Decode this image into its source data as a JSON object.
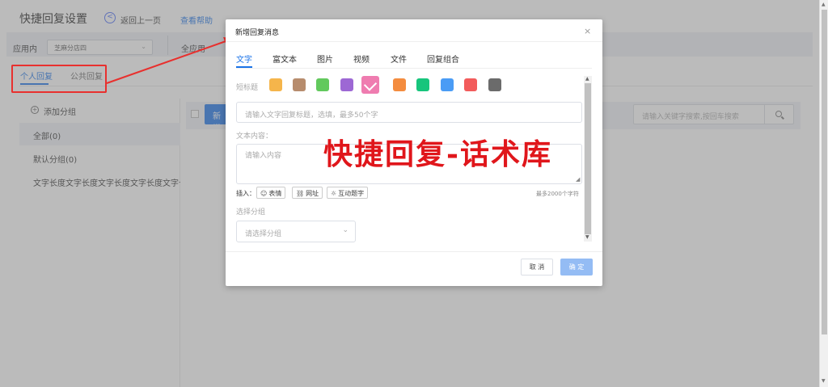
{
  "header": {
    "title": "快捷回复设置",
    "back_label": "返回上一页",
    "help_label": "查看帮助"
  },
  "app_bar": {
    "label": "应用内",
    "selected_store": "芝麻分店四",
    "all_apps": "全应用"
  },
  "tabs": {
    "personal": "个人回复",
    "public": "公共回复"
  },
  "sidebar": {
    "add_group": "添加分组",
    "groups": [
      "全部(0)",
      "默认分组(0)",
      "文字长度文字长度文字长度文字长度文字长度"
    ]
  },
  "toolbar": {
    "new_button": "新增",
    "search_placeholder": "请输入关键字搜索,按回车搜索"
  },
  "modal": {
    "title": "新增回复消息",
    "close": "×",
    "tabs": [
      "文字",
      "富文本",
      "图片",
      "视频",
      "文件",
      "回复组合"
    ],
    "active_tab": "文字",
    "short_title_label": "短标题",
    "swatch_colors": [
      "#f5b54b",
      "#b78c6d",
      "#62c95d",
      "#9d68d4",
      "#ef7cb0",
      "#f48c3f",
      "#17c57c",
      "#4a9cf5",
      "#f25b5b",
      "#6b6b6b"
    ],
    "selected_swatch_index": 4,
    "title_placeholder": "请输入文字回复标题，选填，最多50个字",
    "content_label": "文本内容：",
    "content_placeholder": "请输入内容",
    "insert_label": "插入：",
    "insert_buttons": [
      "表情",
      "网址",
      "互动题字"
    ],
    "max_hint": "最多2000个字符",
    "group_label": "选择分组",
    "group_placeholder": "请选择分组",
    "cancel_label": "取 消",
    "ok_label": "确 定"
  },
  "watermark": "快捷回复-话术库"
}
